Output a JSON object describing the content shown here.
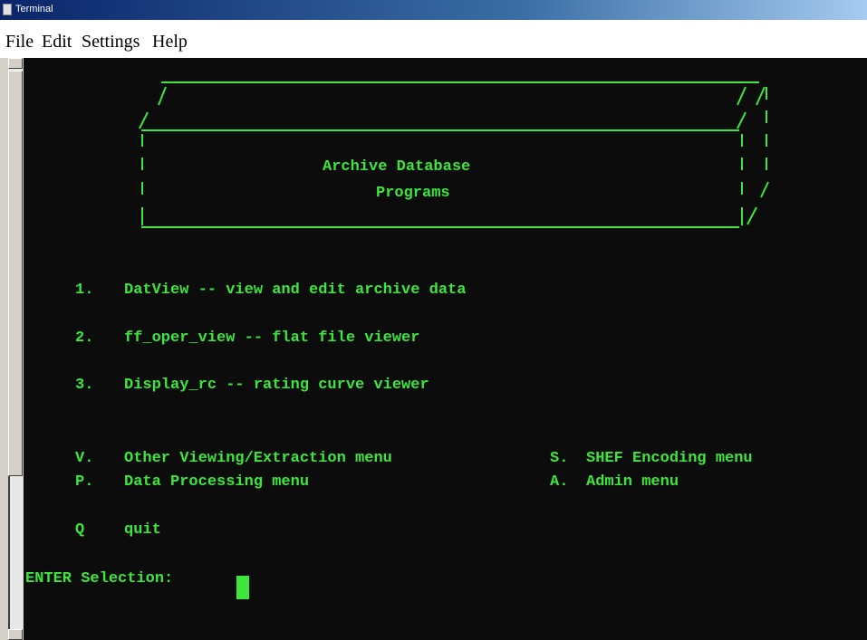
{
  "window": {
    "title": "Terminal"
  },
  "menubar": {
    "items": [
      "File",
      "Edit",
      "Settings",
      "Help"
    ]
  },
  "banner": {
    "line1": "Archive Database",
    "line2": "Programs"
  },
  "programs": [
    {
      "key": "1.",
      "label": "DatView -- view and edit archive data"
    },
    {
      "key": "2.",
      "label": "ff_oper_view -- flat file viewer"
    },
    {
      "key": "3.",
      "label": "Display_rc -- rating curve viewer"
    }
  ],
  "menus_left": [
    {
      "key": "V.",
      "label": "Other Viewing/Extraction menu"
    },
    {
      "key": "P.",
      "label": "Data Processing menu"
    }
  ],
  "menus_right": [
    {
      "key": "S.",
      "label": "SHEF Encoding menu"
    },
    {
      "key": "A.",
      "label": "Admin menu"
    }
  ],
  "quit": {
    "key": "Q",
    "label": "quit"
  },
  "prompt": {
    "text": "ENTER Selection:"
  },
  "colors": {
    "terminal_bg": "#0c0c0c",
    "terminal_fg": "#3ce63c"
  }
}
